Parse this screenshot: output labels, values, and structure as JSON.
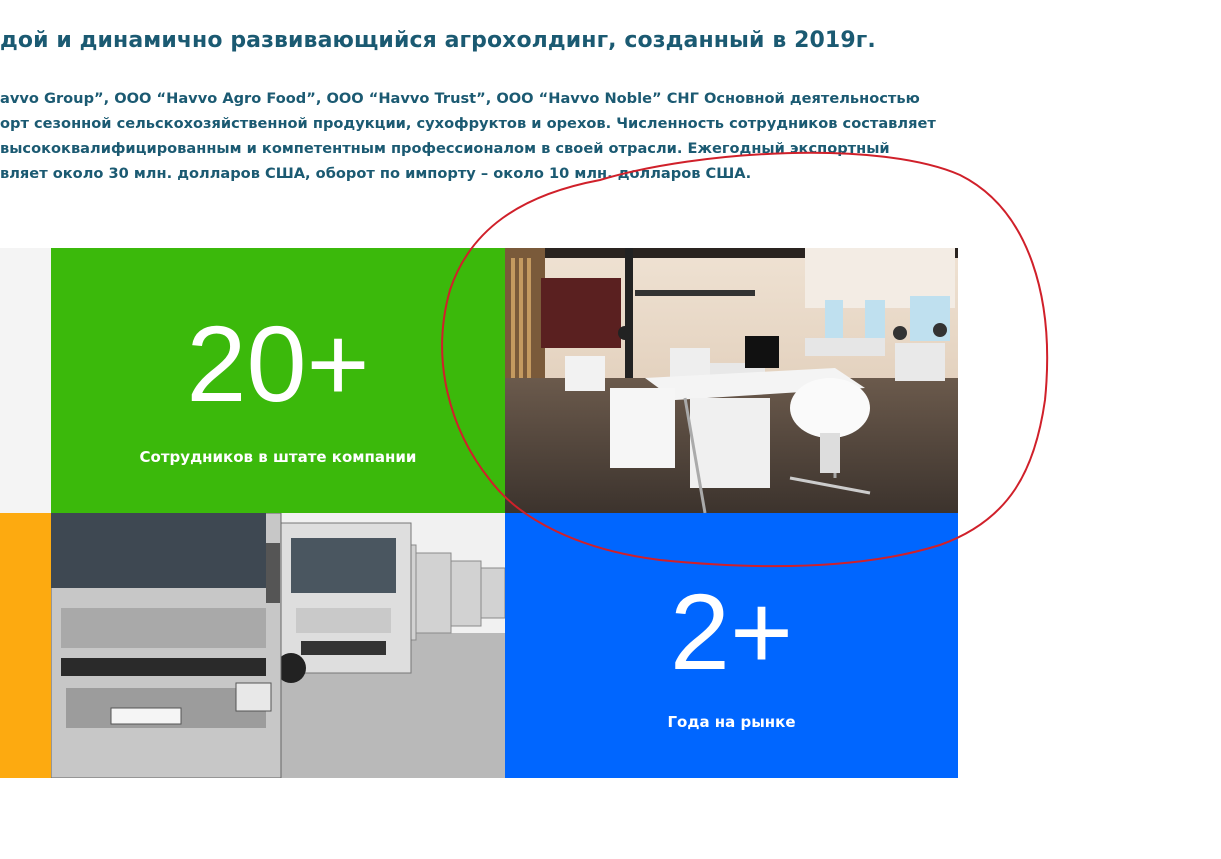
{
  "heading": "дой и динамично развивающийся агрохолдинг, созданный в 2019г.",
  "intro_lines": [
    "avvo Group”, ООО “Havvo Agro Food”, ООО “Havvo Trust”, ООО “Havvo Noble” СНГ Основной деятельностью",
    "орт сезонной сельскохозяйственной продукции, сухофруктов и орехов. Численность сотрудников составляет",
    "высококвалифицированным и компетентным профессионалом в своей отрасли. Ежегодный экспортный",
    "вляет около 30 млн. долларов США, оборот по импорту – около 10 млн. долларов США."
  ],
  "stats": {
    "employees": {
      "number": "20+",
      "label": "Сотрудников в штате компании"
    },
    "years": {
      "number": "2+",
      "label": "Года на рынке"
    }
  },
  "colors": {
    "text": "#1b5a72",
    "green": "#3bb90b",
    "blue": "#0066ff",
    "orange": "#fdaa10",
    "gray": "#f4f4f4",
    "annotation": "#d0202a"
  },
  "images": {
    "office": "office-photo",
    "trucks": "trucks-photo"
  }
}
